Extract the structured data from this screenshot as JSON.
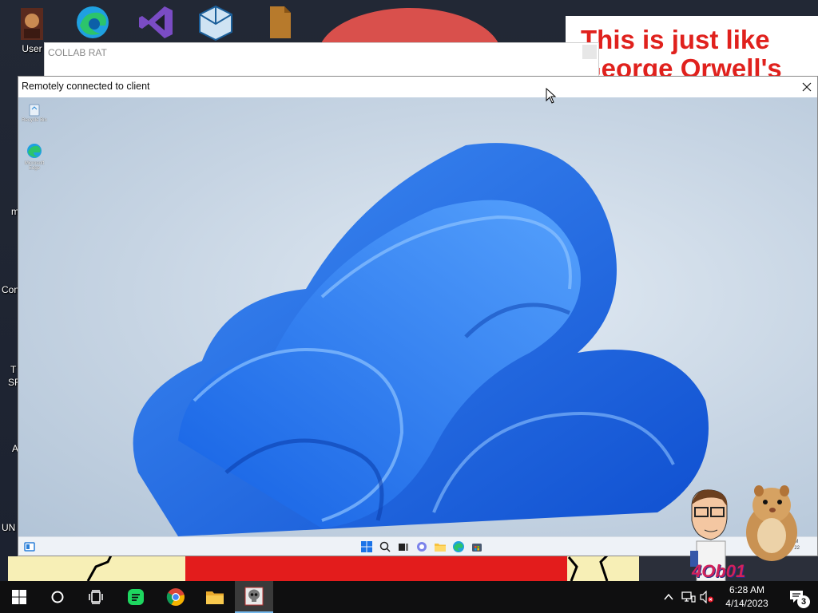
{
  "host_desktop": {
    "meme_text_line1": "This is just like",
    "meme_text_line2": "George Orwell's",
    "icons": [
      {
        "label": "User",
        "icon": "user-folder-icon"
      },
      {
        "label": "",
        "icon": "edge-icon"
      },
      {
        "label": "",
        "icon": "visual-studio-icon"
      },
      {
        "label": "",
        "icon": "virtualbox-icon"
      },
      {
        "label": "",
        "icon": "file-icon"
      }
    ],
    "edge_labels": [
      "m",
      "Con",
      "T",
      "SF",
      "A",
      "UN"
    ]
  },
  "rat_window": {
    "title": "COLLAB RAT"
  },
  "viewer_window": {
    "title": "Remotely connected to client",
    "close_icon": "close-icon",
    "remote_desktop": {
      "icons": [
        {
          "label": "Recycle Bin",
          "icon": "recycle-bin-icon"
        },
        {
          "label": "Microsoft Edge",
          "icon": "edge-icon"
        }
      ],
      "taskbar_icons": [
        "widgets-icon",
        "start-icon",
        "search-icon",
        "task-view-icon",
        "chat-icon",
        "file-explorer-icon",
        "edge-icon",
        "store-icon"
      ],
      "tray_time": "M",
      "tray_date": "22"
    }
  },
  "overlays": {
    "sticker_text": "4Ob01"
  },
  "taskbar": {
    "buttons": [
      {
        "name": "start",
        "icon": "windows-logo-icon"
      },
      {
        "name": "search",
        "icon": "cortana-circle-icon"
      },
      {
        "name": "task-view",
        "icon": "task-view-icon"
      },
      {
        "name": "spotify-app",
        "icon": "green-chat-app-icon"
      },
      {
        "name": "chrome",
        "icon": "chrome-icon"
      },
      {
        "name": "file-explorer",
        "icon": "folder-icon"
      },
      {
        "name": "rat-app",
        "icon": "skull-app-icon"
      }
    ],
    "tray": {
      "time": "6:28 AM",
      "date": "4/14/2023",
      "notification_count": "3"
    }
  },
  "colors": {
    "taskbar_bg": "#0f0f10",
    "accent": "#76b9ed",
    "windows_blue": "#1e6fe0",
    "meme_red": "#e0211d"
  }
}
